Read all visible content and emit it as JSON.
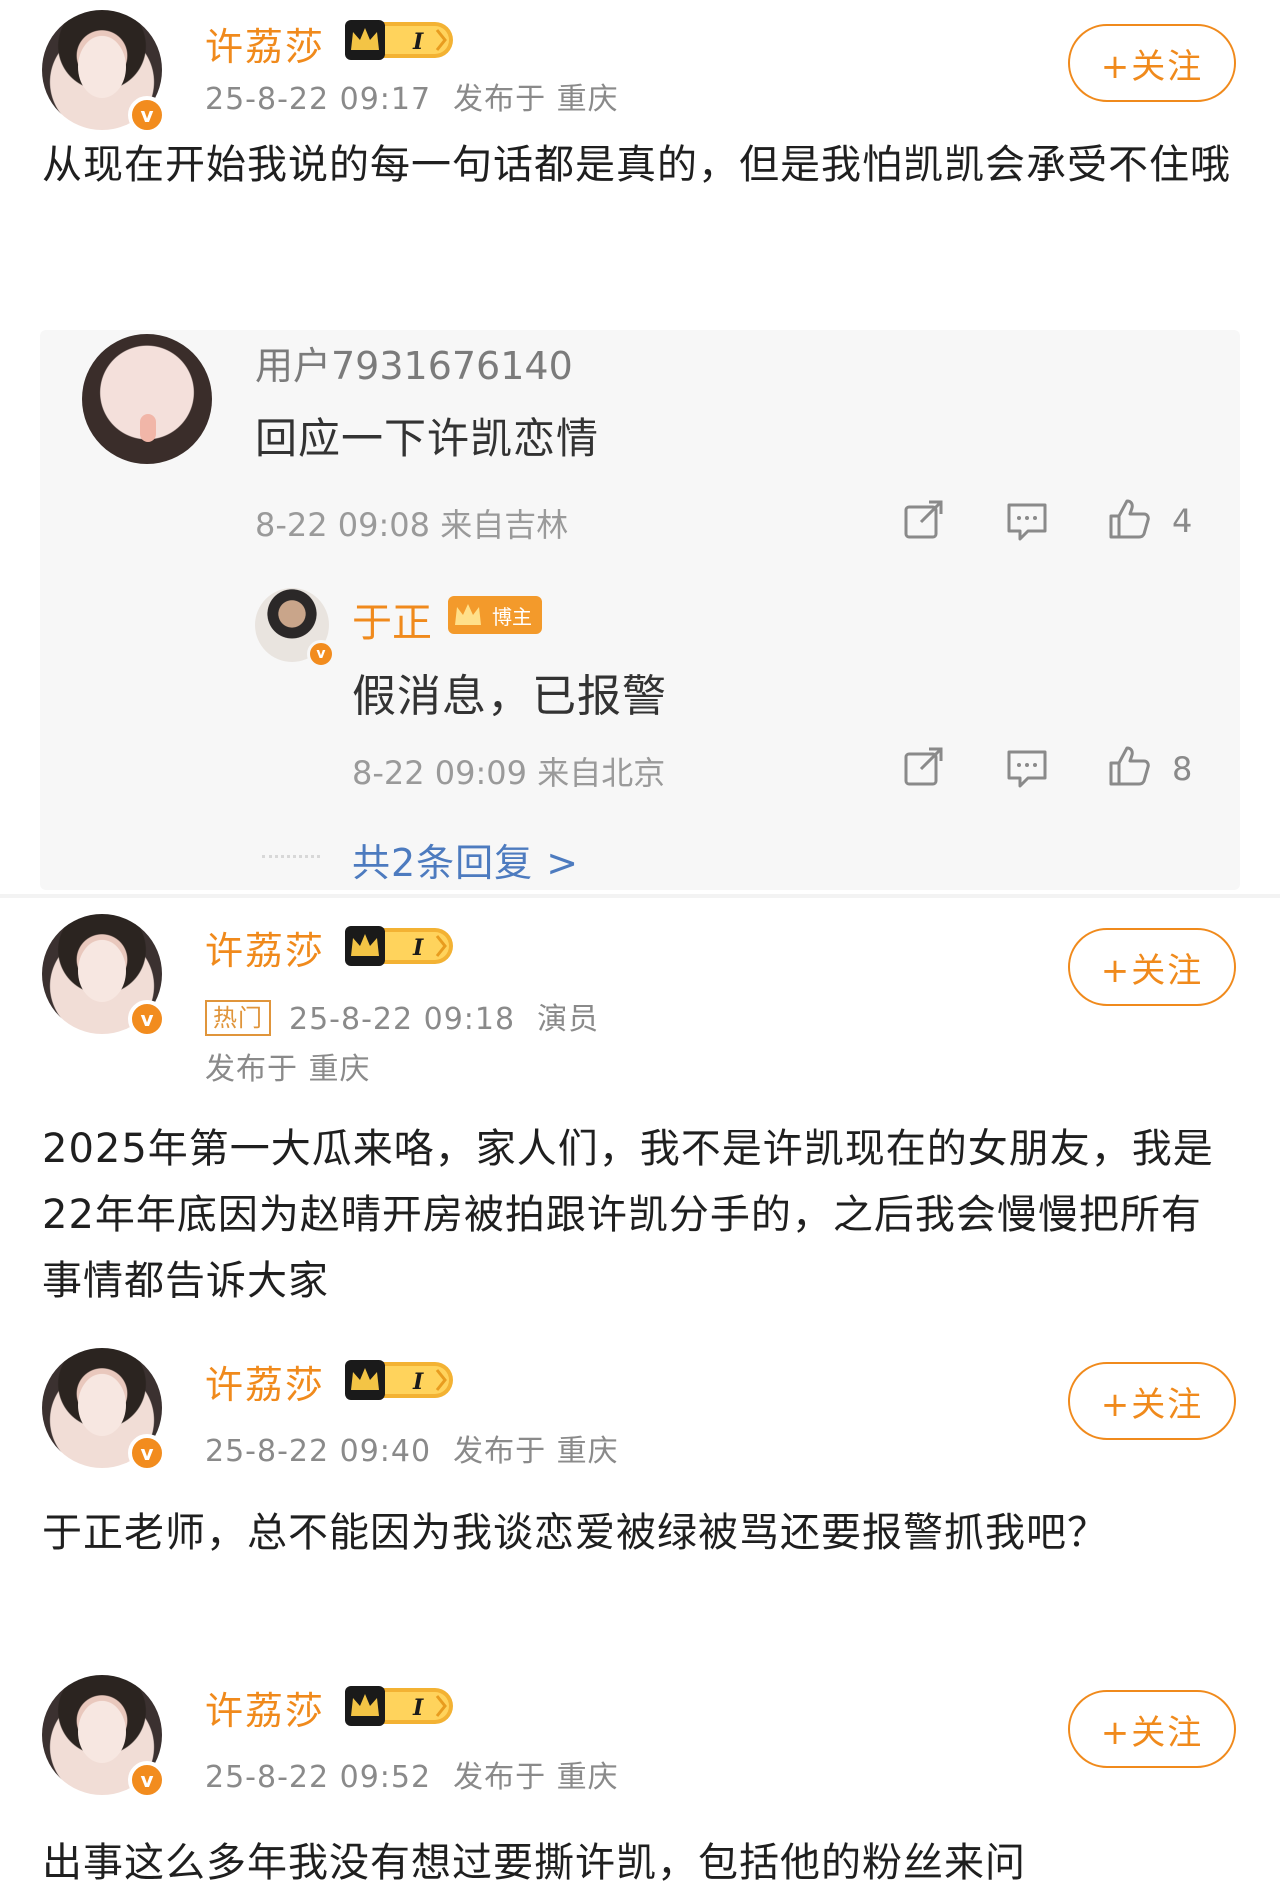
{
  "posts": [
    {
      "username": "许荔莎",
      "time": "25-8-22 09:17",
      "location": "发布于 重庆",
      "follow_label": "+关注",
      "body": "从现在开始我说的每一句话都是真的，但是我怕凯凯会承受不住哦",
      "reply_thread": {
        "comment": {
          "username": "用户7931676140",
          "text": "回应一下许凯恋情",
          "meta": "8-22 09:08 来自吉林",
          "likes": "4"
        },
        "reply": {
          "username": "于正",
          "badge": "博主",
          "text": "假消息，已报警",
          "meta": "8-22 09:09 来自北京",
          "likes": "8"
        },
        "more_replies": "共2条回复 >"
      }
    },
    {
      "username": "许荔莎",
      "hot_tag": "热门",
      "time": "25-8-22 09:18",
      "role": "演员",
      "location": "发布于 重庆",
      "follow_label": "+关注",
      "body": "2025年第一大瓜来咯，家人们，我不是许凯现在的女朋友，我是22年年底因为赵晴开房被拍跟许凯分手的，之后我会慢慢把所有事情都告诉大家"
    },
    {
      "username": "许荔莎",
      "time": "25-8-22 09:40",
      "location": "发布于 重庆",
      "follow_label": "+关注",
      "body": "于正老师，总不能因为我谈恋爱被绿被骂还要报警抓我吧？"
    },
    {
      "username": "许荔莎",
      "time": "25-8-22 09:52",
      "location": "发布于 重庆",
      "follow_label": "+关注",
      "body": "出事这么多年我没有想过要撕许凯，包括他的粉丝来问"
    }
  ],
  "icons": {
    "verified": "v",
    "level": "I",
    "share": "share-icon",
    "comment": "comment-icon",
    "like": "thumbs-up-icon"
  },
  "colors": {
    "accent": "#f08a1c",
    "link": "#4d7bbf",
    "muted": "#8a8a8a",
    "reply_bg": "#f7f7f7"
  }
}
